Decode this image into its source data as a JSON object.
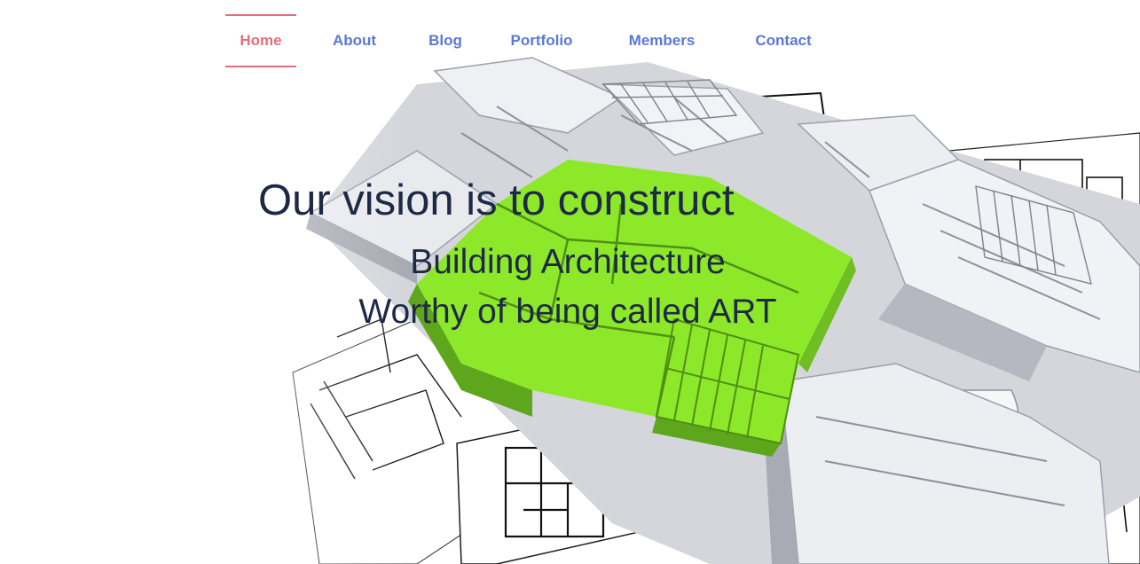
{
  "nav": {
    "items": [
      {
        "label": "Home",
        "active": true
      },
      {
        "label": "About",
        "active": false
      },
      {
        "label": "Blog",
        "active": false
      },
      {
        "label": "Portfolio",
        "active": false
      },
      {
        "label": "Members",
        "active": false
      },
      {
        "label": "Contact",
        "active": false
      }
    ],
    "colors": {
      "link": "#5b78d8",
      "active": "#e0707a"
    }
  },
  "hero": {
    "title": "Our vision is to construct",
    "subtitle_line1": "Building Architecture",
    "subtitle_line2": "Worthy of being called ART",
    "text_color": "#1e2a45",
    "image": {
      "description_icon": "architecture-model-illustration",
      "accent_color": "#8ee82a"
    }
  }
}
